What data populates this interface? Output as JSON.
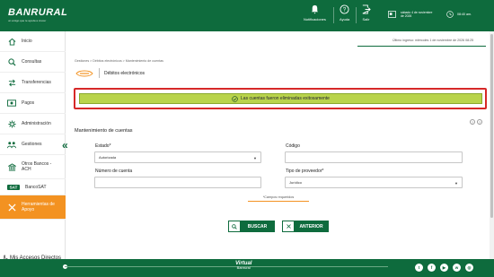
{
  "header": {
    "logo": "BANRURAL",
    "logo_tagline": "un amigo que te ayuda a crecer",
    "notifications": "Notificaciones",
    "help": "Ayuda",
    "exit": "Salir",
    "session": "sábado 4 de noviembre de 2026",
    "clock": "08:40 am."
  },
  "sidebar": {
    "items": [
      {
        "label": "Inicio",
        "icon": "home-icon"
      },
      {
        "label": "Consultas",
        "icon": "search-icon"
      },
      {
        "label": "Transferencias",
        "icon": "transfer-icon"
      },
      {
        "label": "Pagos",
        "icon": "payments-icon"
      },
      {
        "label": "Administración",
        "icon": "admin-icon"
      },
      {
        "label": "Gestiones",
        "icon": "management-icon"
      },
      {
        "label": "Otros Bancos - ACH",
        "icon": "bank-icon"
      },
      {
        "label": "BancoSAT",
        "icon": "sat-icon"
      },
      {
        "label": "Herramientas de Apoyo",
        "icon": "tools-icon"
      }
    ],
    "accesos_title": "Mis Accesos Directos",
    "accesos_empty": "No hay acceso directo definido."
  },
  "main": {
    "last_login": "Último ingreso: miércoles 1 de noviembre de 2026 08:25",
    "breadcrumb": "Gestiones > Débitos electrónicos > Mantenimiento de cuentas",
    "page_title": "Débitos electrónicos",
    "alert": "Las cuentas fueron eliminadas exitosamente",
    "section_title": "Mantenimiento de cuentas",
    "form": {
      "estado_label": "Estado*",
      "estado_value": "Autorizada",
      "codigo_label": "Código",
      "codigo_value": "",
      "numero_label": "Número de cuenta",
      "numero_value": "",
      "tipo_label": "Tipo de proveedor*",
      "tipo_value": "Jurídico"
    },
    "required_note": "*Campos requeridos",
    "buscar": "BUSCAR",
    "anterior": "ANTERIOR"
  },
  "footer": {
    "brand": "Virtual",
    "brand_sub": "Banrural"
  },
  "colors": {
    "brand_green": "#0e6b3d",
    "accent_orange": "#f39221",
    "alert_green": "#b9d44b",
    "highlight_red": "#d62828"
  }
}
